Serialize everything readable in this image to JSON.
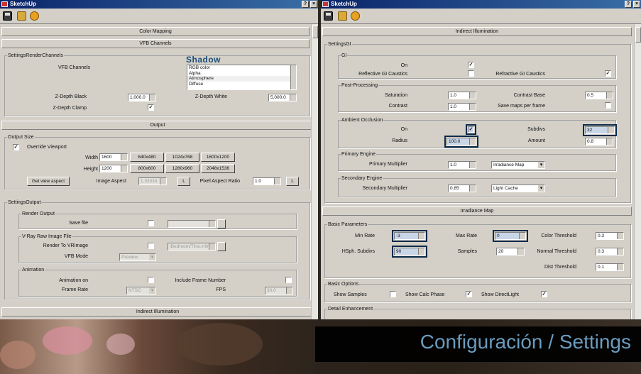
{
  "left": {
    "title": "SketchUp",
    "rollouts": {
      "color_mapping": "Color Mapping",
      "vfb": "VFB Channels",
      "output": "Output",
      "indirect": "Indirect Illumination"
    },
    "settings_render_channels": {
      "group": "SettingsRenderChannels",
      "vfb_label": "VFB Channels",
      "overlay": "Shadow",
      "channels": [
        "RGB color",
        "Alpha",
        "Atmosphere",
        "Diffuse"
      ],
      "zdepth_black_label": "Z-Depth Black",
      "zdepth_black": "1,000.0",
      "zdepth_white_label": "Z-Depth White",
      "zdepth_white": "5,000.0",
      "zdepth_clamp_label": "Z-Depth Clamp",
      "zdepth_clamp": "✓"
    },
    "output_size": {
      "group": "Output Size",
      "override_label": "Override Viewport",
      "override": "✓",
      "width_label": "Width",
      "width": "1600",
      "height_label": "Height",
      "height": "1200",
      "presets": [
        "640x480",
        "1024x768",
        "1600x1200",
        "800x600",
        "1280x960",
        "2048x1536"
      ],
      "aspect_btn": "Get view aspect",
      "image_aspect_label": "Image Aspect",
      "image_aspect": "1.33333",
      "lock_label": "L",
      "pixel_aspect_label": "Pixel Aspect Ratio",
      "pixel_aspect": "1.0",
      "lock2_label": "L"
    },
    "settings_output": {
      "group": "SettingsOutput",
      "render_output_group": "Render Output",
      "save_file_label": "Save file",
      "vray_raw_group": "V-Ray Raw Image File",
      "render_to_vr_label": "Render To VRImage",
      "vr_path": "\\Bedroom/Tina.vrimg",
      "vfb_mode_label": "VFB Mode",
      "vfb_mode": "Preview",
      "animation_group": "Animation",
      "animation_on_label": "Animation on",
      "include_frame_label": "Include Frame Number",
      "frame_rate_label": "Frame Rate",
      "frame_rate": "NTSC",
      "fps_label": "FPS",
      "fps": "30.0"
    }
  },
  "right": {
    "title": "SketchUp",
    "rollouts": {
      "indirect": "Indirect Illumination",
      "irradiance": "Irradiance Map"
    },
    "settings_gi": {
      "group": "SettingsGI",
      "gi_group": "GI",
      "on_label": "On",
      "on": "✓",
      "refl_label": "Reflective GI Caustics",
      "refr_label": "Refractive GI Caustics",
      "refr": "✓"
    },
    "post": {
      "group": "Post-Processing",
      "saturation_label": "Saturation",
      "saturation": "1.0",
      "contrast_base_label": "Contrast Base",
      "contrast_base": "0.5",
      "contrast_label": "Contrast",
      "contrast": "1.0",
      "save_maps_label": "Save maps per frame"
    },
    "ao": {
      "group": "Ambient Occlusion",
      "on_label": "On",
      "on": "✓",
      "subdivs_label": "Subdivs",
      "subdivs": "32",
      "radius_label": "Radius",
      "radius": "100.0",
      "amount_label": "Amount",
      "amount": "0.8"
    },
    "primary": {
      "group": "Primary Engine",
      "mult_label": "Primary Multiplier",
      "mult": "1.0",
      "engine": "Irradiance Map"
    },
    "secondary": {
      "group": "Secondary Engine",
      "mult_label": "Secondary Multiplier",
      "mult": "0.85",
      "engine": "Light Cache"
    },
    "basic": {
      "group": "Basic Parameters",
      "min_rate_label": "Min Rate",
      "min_rate": "-3",
      "max_rate_label": "Max Rate",
      "max_rate": "0",
      "color_thr_label": "Color Threshold",
      "color_thr": "0.3",
      "hsph_label": "HSph. Subdivs",
      "hsph": "90",
      "samples_label": "Samples",
      "samples": "20",
      "normal_thr_label": "Normal Threshold",
      "normal_thr": "0.3",
      "dist_thr_label": "Dist Threshold",
      "dist_thr": "0.1"
    },
    "options": {
      "group": "Basic Options",
      "show_samples_label": "Show Samples",
      "show_calc_label": "Show Calc Phase",
      "show_calc": "✓",
      "show_direct_label": "Show DirectLight",
      "show_direct": "✓"
    },
    "detail": {
      "group": "Detail Enhancement"
    }
  },
  "caption": "Configuración / Settings"
}
